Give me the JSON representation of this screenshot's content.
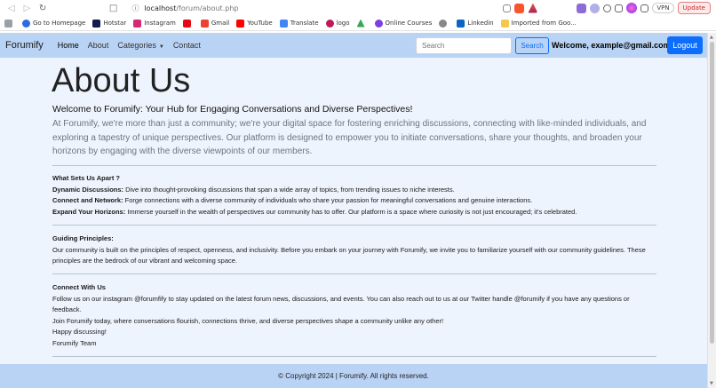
{
  "browser": {
    "url_host": "localhost",
    "url_path": "/forum/about.php",
    "vpn_label": "VPN",
    "update_label": "Update",
    "bookmarks": [
      {
        "label": "Go to Homepage",
        "color": "#2d6cdf"
      },
      {
        "label": "Hotstar",
        "color": "#0f1c4d"
      },
      {
        "label": "Instagram",
        "color": "#d62976"
      },
      {
        "label": "",
        "color": "#e50914"
      },
      {
        "label": "Gmail",
        "color": "#ea4335"
      },
      {
        "label": "YouTube",
        "color": "#ff0000"
      },
      {
        "label": "Translate",
        "color": "#4285f4"
      },
      {
        "label": "logo",
        "color": "#c2185b"
      },
      {
        "label": "",
        "color": "#34a853"
      },
      {
        "label": "Online Courses",
        "color": "#7b3fe4"
      },
      {
        "label": "",
        "color": "#888888"
      },
      {
        "label": "Linkedin",
        "color": "#0a66c2"
      },
      {
        "label": "Imported from Goo...",
        "color": "#f2c94c"
      }
    ]
  },
  "nav": {
    "brand": "Forumify",
    "links": [
      "Home",
      "About",
      "Categories",
      "Contact"
    ],
    "search_placeholder": "Search",
    "search_button": "Search",
    "welcome": "Welcome, example@gmail.com",
    "logout": "Logout"
  },
  "page": {
    "title": "About Us",
    "lead_heading": "Welcome to Forumify: Your Hub for Engaging Conversations and Diverse Perspectives!",
    "lead_text": "At Forumify, we're more than just a community; we're your digital space for fostering enriching discussions, connecting with like-minded individuals, and exploring a tapestry of unique perspectives. Our platform is designed to empower you to initiate conversations, share your thoughts, and broaden your horizons by engaging with the diverse viewpoints of our members.",
    "what_sets_title": "What Sets Us Apart ?",
    "features": [
      {
        "label": "Dynamic Discussions:",
        "text": " Dive into thought-provoking discussions that span a wide array of topics, from trending issues to niche interests."
      },
      {
        "label": "Connect and Network:",
        "text": " Forge connections with a diverse community of individuals who share your passion for meaningful conversations and genuine interactions."
      },
      {
        "label": "Expand Your Horizons:",
        "text": " Immerse yourself in the wealth of perspectives our community has to offer. Our platform is a space where curiosity is not just encouraged; it's celebrated."
      }
    ],
    "principles_title": "Guiding Principles:",
    "principles_text": "Our community is built on the principles of respect, openness, and inclusivity. Before you embark on your journey with Forumify, we invite you to familiarize yourself with our community guidelines. These principles are the bedrock of our vibrant and welcoming space.",
    "connect_title": "Connect With Us",
    "connect_lines": [
      "Follow us on our instagram @forumfify to stay updated on the latest forum news, discussions, and events. You can also reach out to us at our Twitter handle @forumify if you have any questions or feedback.",
      "Join Forumify today, where conversations flourish, connections thrive, and diverse perspectives shape a community unlike any other!",
      "Happy discussing!",
      "Forumify Team"
    ]
  },
  "footer": {
    "copyright": "© Copyright 2024 | Forumify. All rights reserved."
  }
}
